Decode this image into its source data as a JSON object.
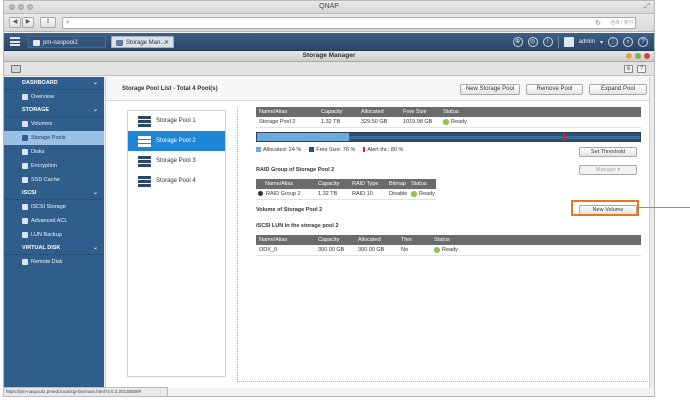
{
  "browser": {
    "window_title": "QNAP",
    "search_placeholder": "검색 / 찾기"
  },
  "qnap_bar": {
    "tabs": [
      {
        "label": "pm-naspool2"
      },
      {
        "label": "Storage Man..."
      }
    ],
    "username": "admin"
  },
  "app": {
    "title": "Storage Manager"
  },
  "sidebar": {
    "sections": [
      {
        "label": "DASHBOARD",
        "items": [
          {
            "label": "Overview"
          }
        ]
      },
      {
        "label": "STORAGE",
        "items": [
          {
            "label": "Volumes"
          },
          {
            "label": "Storage Pools"
          },
          {
            "label": "Disks"
          },
          {
            "label": "Encryption"
          },
          {
            "label": "SSD Cache"
          }
        ]
      },
      {
        "label": "iSCSI",
        "items": [
          {
            "label": "iSCSI Storage"
          },
          {
            "label": "Advanced ACL"
          },
          {
            "label": "LUN Backup"
          }
        ]
      },
      {
        "label": "VIRTUAL DISK",
        "items": [
          {
            "label": "Remote Disk"
          }
        ]
      }
    ],
    "active_item": "Storage Pools"
  },
  "main": {
    "title": "Storage Pool List - Total 4 Pool(s)",
    "buttons": {
      "new_pool": "New Storage Pool",
      "remove_pool": "Remove Pool",
      "expand_pool": "Expand Pool"
    },
    "pools": [
      {
        "label": "Storage Pool 1"
      },
      {
        "label": "Storage Pool 2"
      },
      {
        "label": "Storage Pool 3"
      },
      {
        "label": "Storage Pool 4"
      }
    ],
    "selected_pool": "Storage Pool 2"
  },
  "pool_detail": {
    "headers": [
      "Name/Alias",
      "Capacity",
      "Allocated",
      "Free Size",
      "Status"
    ],
    "row": {
      "name": "Storage Pool 2",
      "capacity": "1.32 TB",
      "allocated": "329.50 GB",
      "free": "1019.98 GB",
      "status": "Ready"
    },
    "usage": {
      "allocated_pct": 24,
      "alert_pct": 80
    },
    "legend": {
      "allocated": "Allocated: 24 %",
      "free": "Free Size: 76 %",
      "alert": "Alert thr.: 80 %"
    },
    "set_threshold": "Set Threshold",
    "colors": {
      "allocated": "#6ea9dc",
      "free": "#2e4e72",
      "alert": "#e02020",
      "highlight": "#e87722"
    }
  },
  "raid_group": {
    "title": "RAID Group of Storage Pool 2",
    "manage_label": "Manage",
    "headers": [
      "Name/Alias",
      "Capacity",
      "RAID Type",
      "Bitmap",
      "Status"
    ],
    "row": {
      "name": "RAID Group 2",
      "capacity": "1.32 TB",
      "raid_type": "RAID 10",
      "bitmap": "Disable",
      "status": "Ready"
    }
  },
  "volume": {
    "title": "Volume of Storage Pool 2",
    "new_volume_label": "New Volume"
  },
  "lun": {
    "title": "iSCSI LUN in the storage pool 2",
    "headers": [
      "Name/Alias",
      "Capacity",
      "Allocated",
      "Thin",
      "Status"
    ],
    "row": {
      "name": "ODX_0",
      "capacity": "300.00 GB",
      "allocated": "300.00 GB",
      "thin": "No",
      "status": "Ready"
    }
  },
  "status_url": "https://pm-naspool2.pmedi.local/cgi-bin/main.html?4.0.3.20130808#"
}
